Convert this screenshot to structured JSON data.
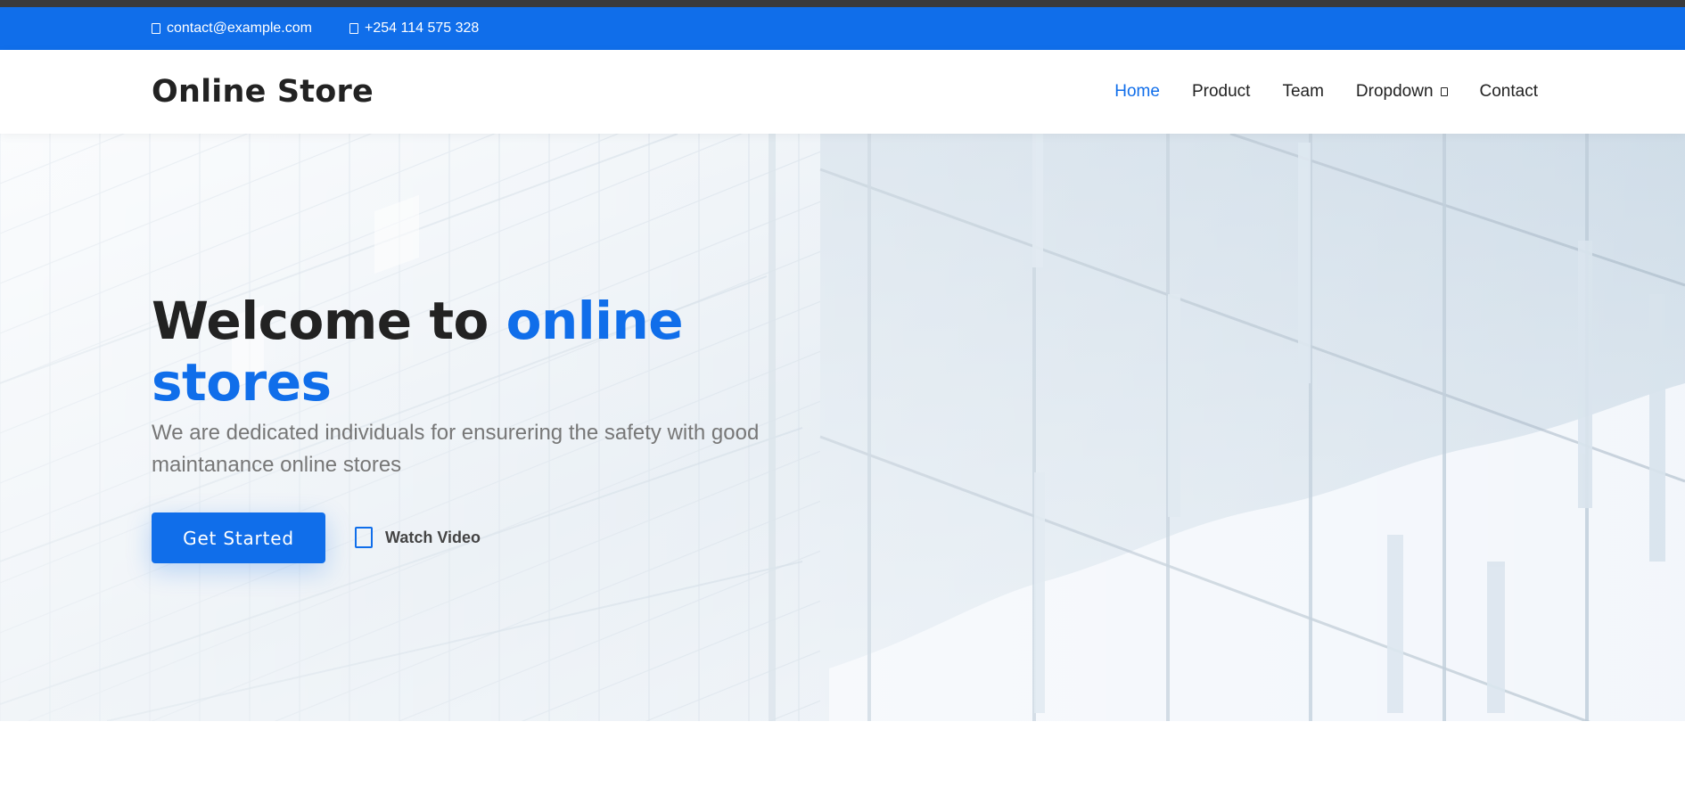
{
  "topbar": {
    "email": "contact@example.com",
    "phone": "+254 114 575 328",
    "email_icon": "envelope-icon",
    "phone_icon": "phone-icon"
  },
  "header": {
    "logo": "Online Store",
    "nav": [
      {
        "label": "Home",
        "active": true
      },
      {
        "label": "Product"
      },
      {
        "label": "Team"
      },
      {
        "label": "Dropdown",
        "icon": "chevron-down-icon"
      },
      {
        "label": "Contact"
      }
    ]
  },
  "hero": {
    "title_prefix": "Welcome to ",
    "title_accent": "online stores",
    "subtitle": "We are dedicated individuals for ensurering the safety with good maintanance online stores",
    "cta_label": "Get Started",
    "video_label": "Watch Video",
    "video_icon": "play-icon"
  },
  "colors": {
    "primary": "#106eea",
    "text_dark": "#222222",
    "text_muted": "#777777"
  }
}
